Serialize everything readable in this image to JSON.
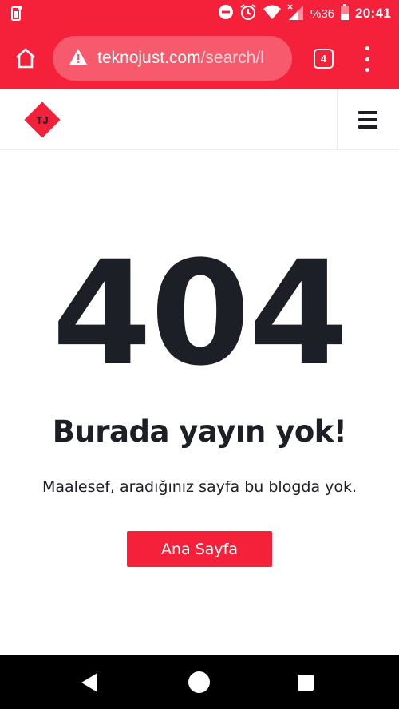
{
  "status_bar": {
    "time": "20:41",
    "battery": "%36",
    "icons": [
      "phone-icon",
      "do-not-disturb-icon",
      "alarm-icon",
      "wifi-icon",
      "signal-icon",
      "battery-icon"
    ]
  },
  "browser": {
    "url_domain": "teknojust.com",
    "url_path": "/search/l",
    "tab_count": "4",
    "icons": [
      "home-icon",
      "warning-icon",
      "tabs-icon",
      "more-vert-icon"
    ]
  },
  "site_header": {
    "logo_text": "TJ",
    "icons": [
      "hamburger-menu-icon"
    ]
  },
  "error_page": {
    "code": "404",
    "headline": "Burada yayın yok!",
    "message": "Maalesef, aradığınız sayfa bu blogda yok.",
    "home_button_label": "Ana Sayfa"
  },
  "android_nav": {
    "icons": [
      "back-icon",
      "home-circle-icon",
      "recents-icon"
    ]
  },
  "colors": {
    "brand_red": "#f5213a",
    "url_bar_bg": "#f75a6c",
    "text_dark": "#1d1f26",
    "nav_bar_bg": "#000000"
  }
}
